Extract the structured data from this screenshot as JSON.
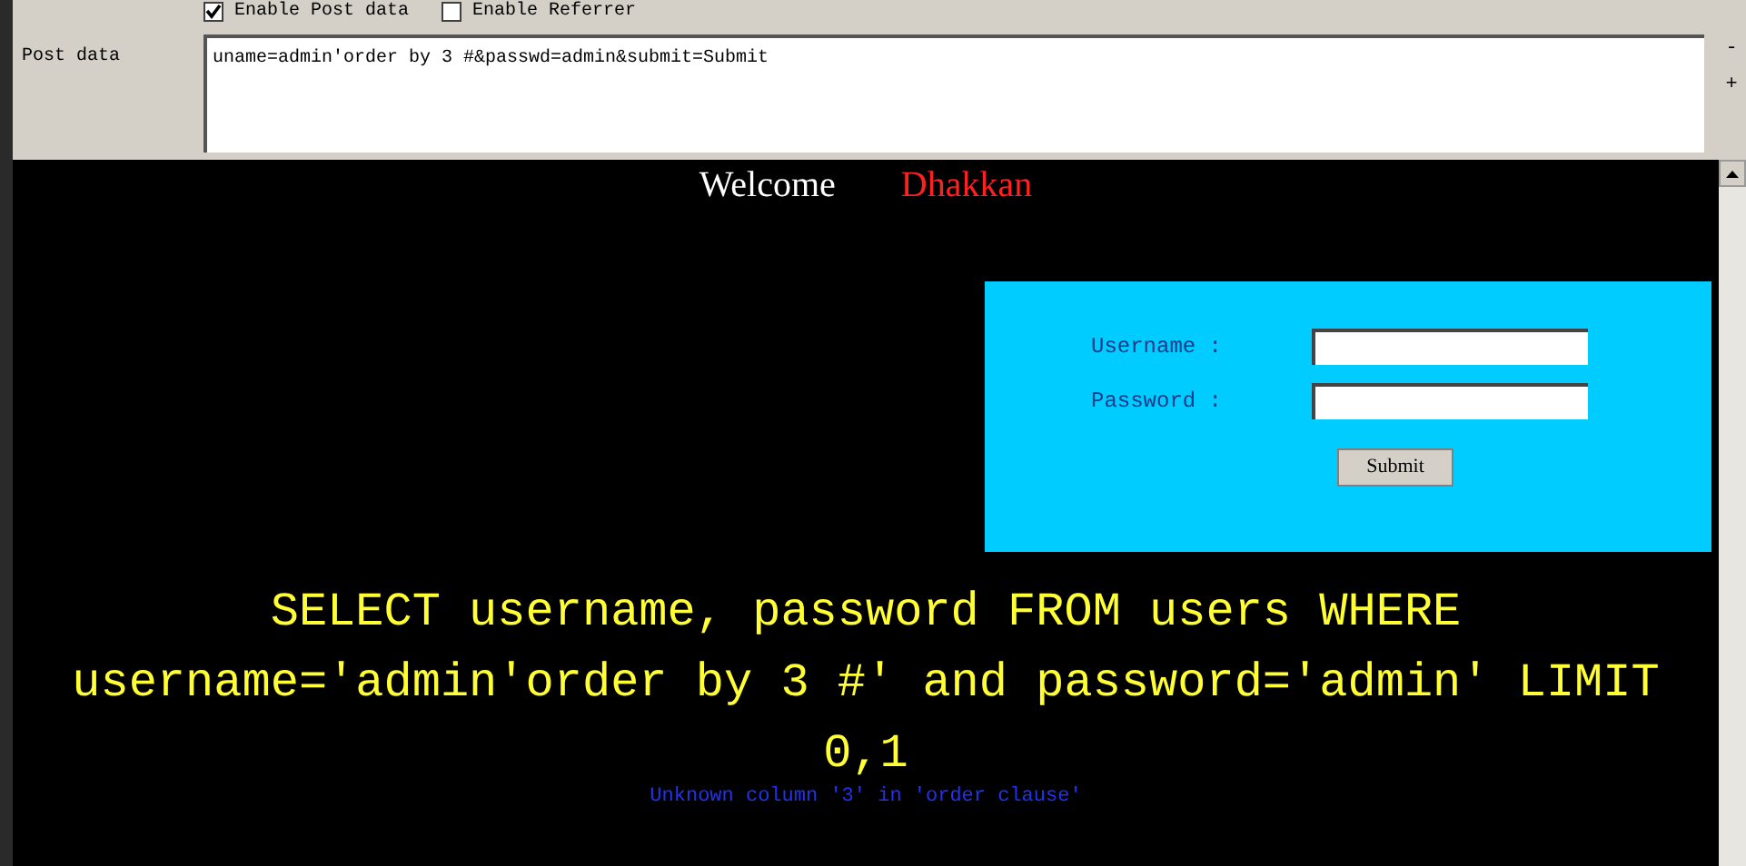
{
  "options": [
    {
      "label": "Enable Post data",
      "checked": true
    },
    {
      "label": "Enable Referrer",
      "checked": false
    }
  ],
  "post_data": {
    "label": "Post data",
    "value": "uname=admin'order by 3 #&passwd=admin&submit=Submit"
  },
  "side_buttons": [
    "-",
    "+"
  ],
  "page": {
    "welcome": "Welcome",
    "name": "Dhakkan",
    "login": {
      "fields": [
        {
          "label": "Username :"
        },
        {
          "label": "Password :"
        }
      ],
      "submit": "Submit"
    },
    "query": "SELECT username, password FROM users WHERE username='admin'order by 3 #' and password='admin' LIMIT 0,1",
    "error": "Unknown column '3' in 'order clause'"
  }
}
